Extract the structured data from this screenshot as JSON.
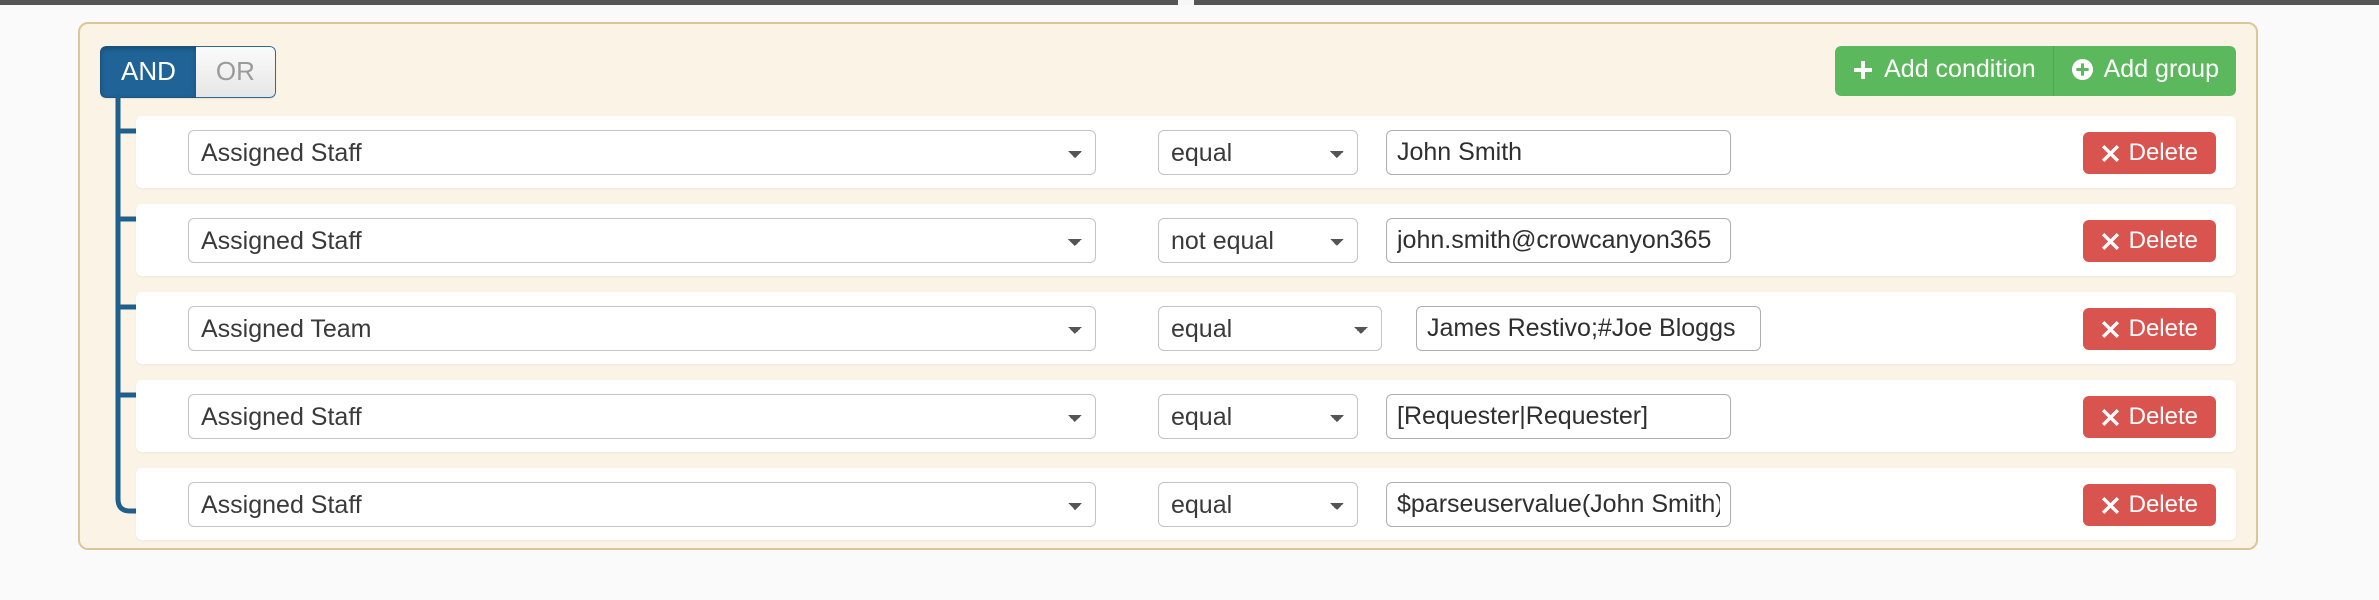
{
  "builder": {
    "conjunction": {
      "options": [
        "AND",
        "OR"
      ],
      "selected": "AND",
      "and_label": "AND",
      "or_label": "OR"
    },
    "actions": {
      "add_condition_label": "Add condition",
      "add_condition_icon": "plus-icon",
      "add_group_label": "Add group",
      "add_group_icon": "plus-circle-icon"
    },
    "delete_label": "Delete",
    "delete_icon": "close-x-icon",
    "field_options": [
      "Assigned Staff",
      "Assigned Team"
    ],
    "operator_options": [
      "equal",
      "not equal"
    ],
    "rules": [
      {
        "field": "Assigned Staff",
        "operator": "equal",
        "value": "John Smith",
        "delete_label": "Delete"
      },
      {
        "field": "Assigned Staff",
        "operator": "not equal",
        "value": "john.smith@crowcanyon365",
        "delete_label": "Delete"
      },
      {
        "field": "Assigned Team",
        "operator": "equal",
        "value": "James Restivo;#Joe Bloggs",
        "delete_label": "Delete"
      },
      {
        "field": "Assigned Staff",
        "operator": "equal",
        "value": "[Requester|Requester]",
        "delete_label": "Delete"
      },
      {
        "field": "Assigned Staff",
        "operator": "equal",
        "value": "$parseuservalue(John Smith)",
        "delete_label": "Delete"
      }
    ]
  },
  "colors": {
    "group_bg": "#faf3e6",
    "group_border": "#d9c79a",
    "and_active": "#1f6397",
    "add_green": "#5cb85c",
    "delete_red": "#d9534f",
    "tree_line": "#1f5f8b"
  }
}
